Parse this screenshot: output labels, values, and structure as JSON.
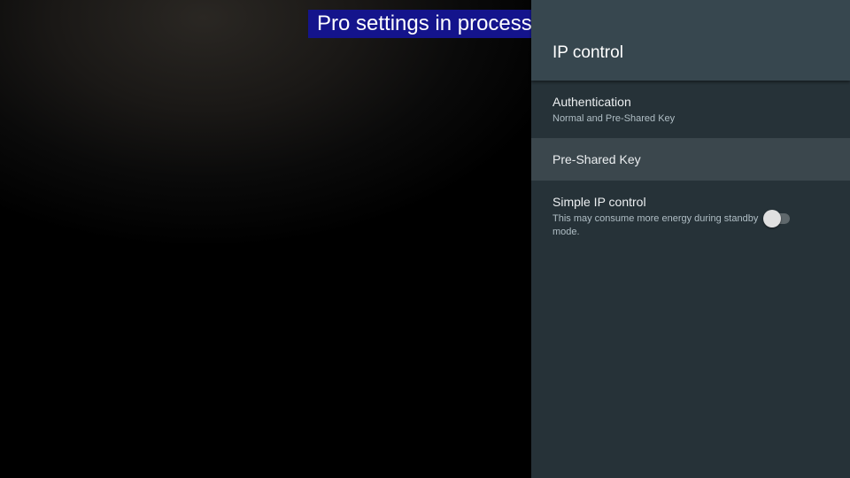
{
  "banner": {
    "text": "Pro settings in process"
  },
  "panel": {
    "title": "IP control",
    "items": [
      {
        "title": "Authentication",
        "summary": "Normal and Pre-Shared Key"
      },
      {
        "title": "Pre-Shared Key"
      },
      {
        "title": "Simple IP control",
        "summary": "This may consume more energy during standby mode.",
        "switch_state": "off"
      }
    ]
  },
  "colors": {
    "panel_background": "#263238",
    "header_background": "#37474f",
    "focused_item": "#3b474d",
    "banner_background": "#14148c"
  }
}
